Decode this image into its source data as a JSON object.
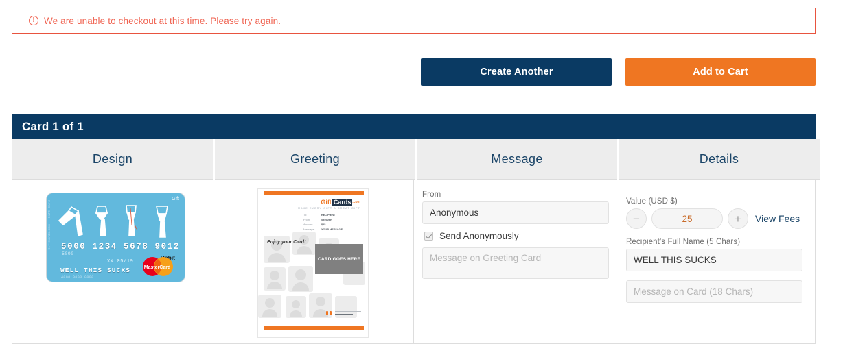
{
  "alert": {
    "icon": "exclamation-circle-icon",
    "message": "We are unable to checkout at this time. Please try again."
  },
  "actions": {
    "create_another": "Create Another",
    "add_to_cart": "Add to Cart"
  },
  "panel": {
    "title": "Card 1 of 1",
    "columns": [
      {
        "label": "Design"
      },
      {
        "label": "Greeting"
      },
      {
        "label": "Message"
      },
      {
        "label": "Details"
      }
    ]
  },
  "design": {
    "gift_badge": "Gift",
    "side_text": "GiftCards.com  •  Gift Card",
    "card_number": "5000 1234 5678 9012",
    "card_number_sub": "5000",
    "expiry": "XX 05/19",
    "cardholder": "WELL THIS SUCKS",
    "footer_code": "4000 0000 0000",
    "network": "MasterCard",
    "network_type": "Debit"
  },
  "greeting": {
    "logo_gift": "Gift",
    "logo_cards": "Cards",
    "logo_tm": ".com",
    "logo_sub": "MAKE  EVERY  GIFT  A  GREAT  GIFT",
    "meta": [
      {
        "key": "To:",
        "value": "RECIPIENT"
      },
      {
        "key": "From:",
        "value": "SENDER"
      },
      {
        "key": "Amount:",
        "value": "$25"
      },
      {
        "key": "Message:",
        "value": "YOUR MESSAGE"
      }
    ],
    "enjoy_text": "Enjoy your Card!",
    "card_placeholder": "CARD GOES HERE"
  },
  "message": {
    "from_label": "From",
    "from_value": "Anonymous",
    "anonymous_checkbox_label": "Send Anonymously",
    "anonymous_checked": true,
    "greeting_message_placeholder": "Message on Greeting Card",
    "greeting_message_value": ""
  },
  "details": {
    "value_label": "Value (USD $)",
    "decrement_icon": "minus-icon",
    "increment_icon": "plus-icon",
    "amount": "25",
    "view_fees_label": "View Fees",
    "recipient_label": "Recipient's Full Name (5 Chars)",
    "recipient_value": "WELL THIS SUCKS",
    "card_message_placeholder": "Message on Card (18 Chars)",
    "card_message_value": ""
  },
  "colors": {
    "navy": "#0a3a63",
    "orange": "#ef7622",
    "alert_red": "#f06553",
    "header_gray": "#ededed"
  }
}
